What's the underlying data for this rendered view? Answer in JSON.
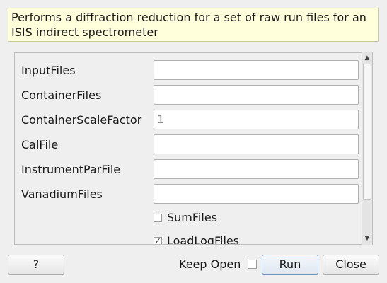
{
  "description": "Performs a diffraction reduction for a set of raw run files for an ISIS indirect spectrometer",
  "fields": [
    {
      "label": "InputFiles",
      "value": ""
    },
    {
      "label": "ContainerFiles",
      "value": ""
    },
    {
      "label": "ContainerScaleFactor",
      "value": "1"
    },
    {
      "label": "CalFile",
      "value": ""
    },
    {
      "label": "InstrumentParFile",
      "value": ""
    },
    {
      "label": "VanadiumFiles",
      "value": ""
    }
  ],
  "checkboxes": [
    {
      "label": "SumFiles",
      "checked": false,
      "mark": ""
    },
    {
      "label": "LoadLogFiles",
      "checked": true,
      "mark": "✓"
    }
  ],
  "footer": {
    "help_label": "?",
    "keep_open_label": "Keep Open",
    "run_label": "Run",
    "close_label": "Close"
  }
}
